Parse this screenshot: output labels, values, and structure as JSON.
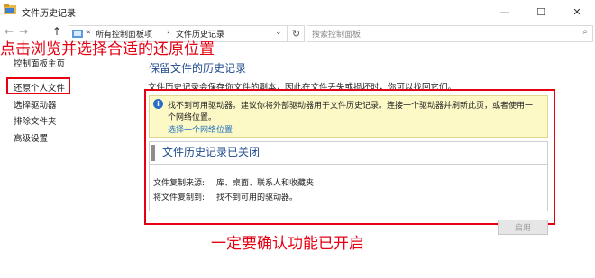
{
  "window": {
    "title": "文件历史记录",
    "minimize_glyph": "—",
    "maximize_glyph": "☐",
    "close_glyph": "✕"
  },
  "nav_buttons": {
    "back_glyph": "←",
    "forward_glyph": "→",
    "up_glyph": "↑"
  },
  "address": {
    "overflow": "«",
    "crumbs": [
      "所有控制面板项",
      "文件历史记录"
    ],
    "separator": "›",
    "dropdown_glyph": "⌄",
    "refresh_glyph": "↻"
  },
  "search": {
    "placeholder": "搜索控制面板"
  },
  "annotations": {
    "top": "点击浏览并选择合适的还原位置",
    "bottom": "一定要确认功能已开启",
    "color": "#e60012"
  },
  "sidebar": {
    "home": "控制面板主页",
    "items": [
      "还原个人文件",
      "选择驱动器",
      "排除文件夹",
      "高级设置"
    ]
  },
  "main": {
    "heading": "保留文件的历史记录",
    "description": "文件历史记录会保存你文件的副本，因此在文件丢失或损坏时，你可以找回它们。",
    "warning": {
      "icon": "i",
      "line1": "找不到可用驱动器。建议你将外部驱动器用于文件历史记录。连接一个驱动器并刷新此页，或者使用一",
      "line2": "个网络位置。",
      "link": "选择一个网络位置"
    },
    "status": {
      "title": "文件历史记录已关闭",
      "copy_from_label": "文件复制来源:",
      "copy_from_value": "库、桌面、联系人和收藏夹",
      "copy_to_label": "将文件复制到:",
      "copy_to_value": "找不到可用的驱动器。"
    },
    "enable_button": "启用"
  },
  "colors": {
    "heading_blue": "#1e4a8a",
    "link_blue": "#1f6fc1",
    "warning_bg": "#fdf9c7"
  }
}
